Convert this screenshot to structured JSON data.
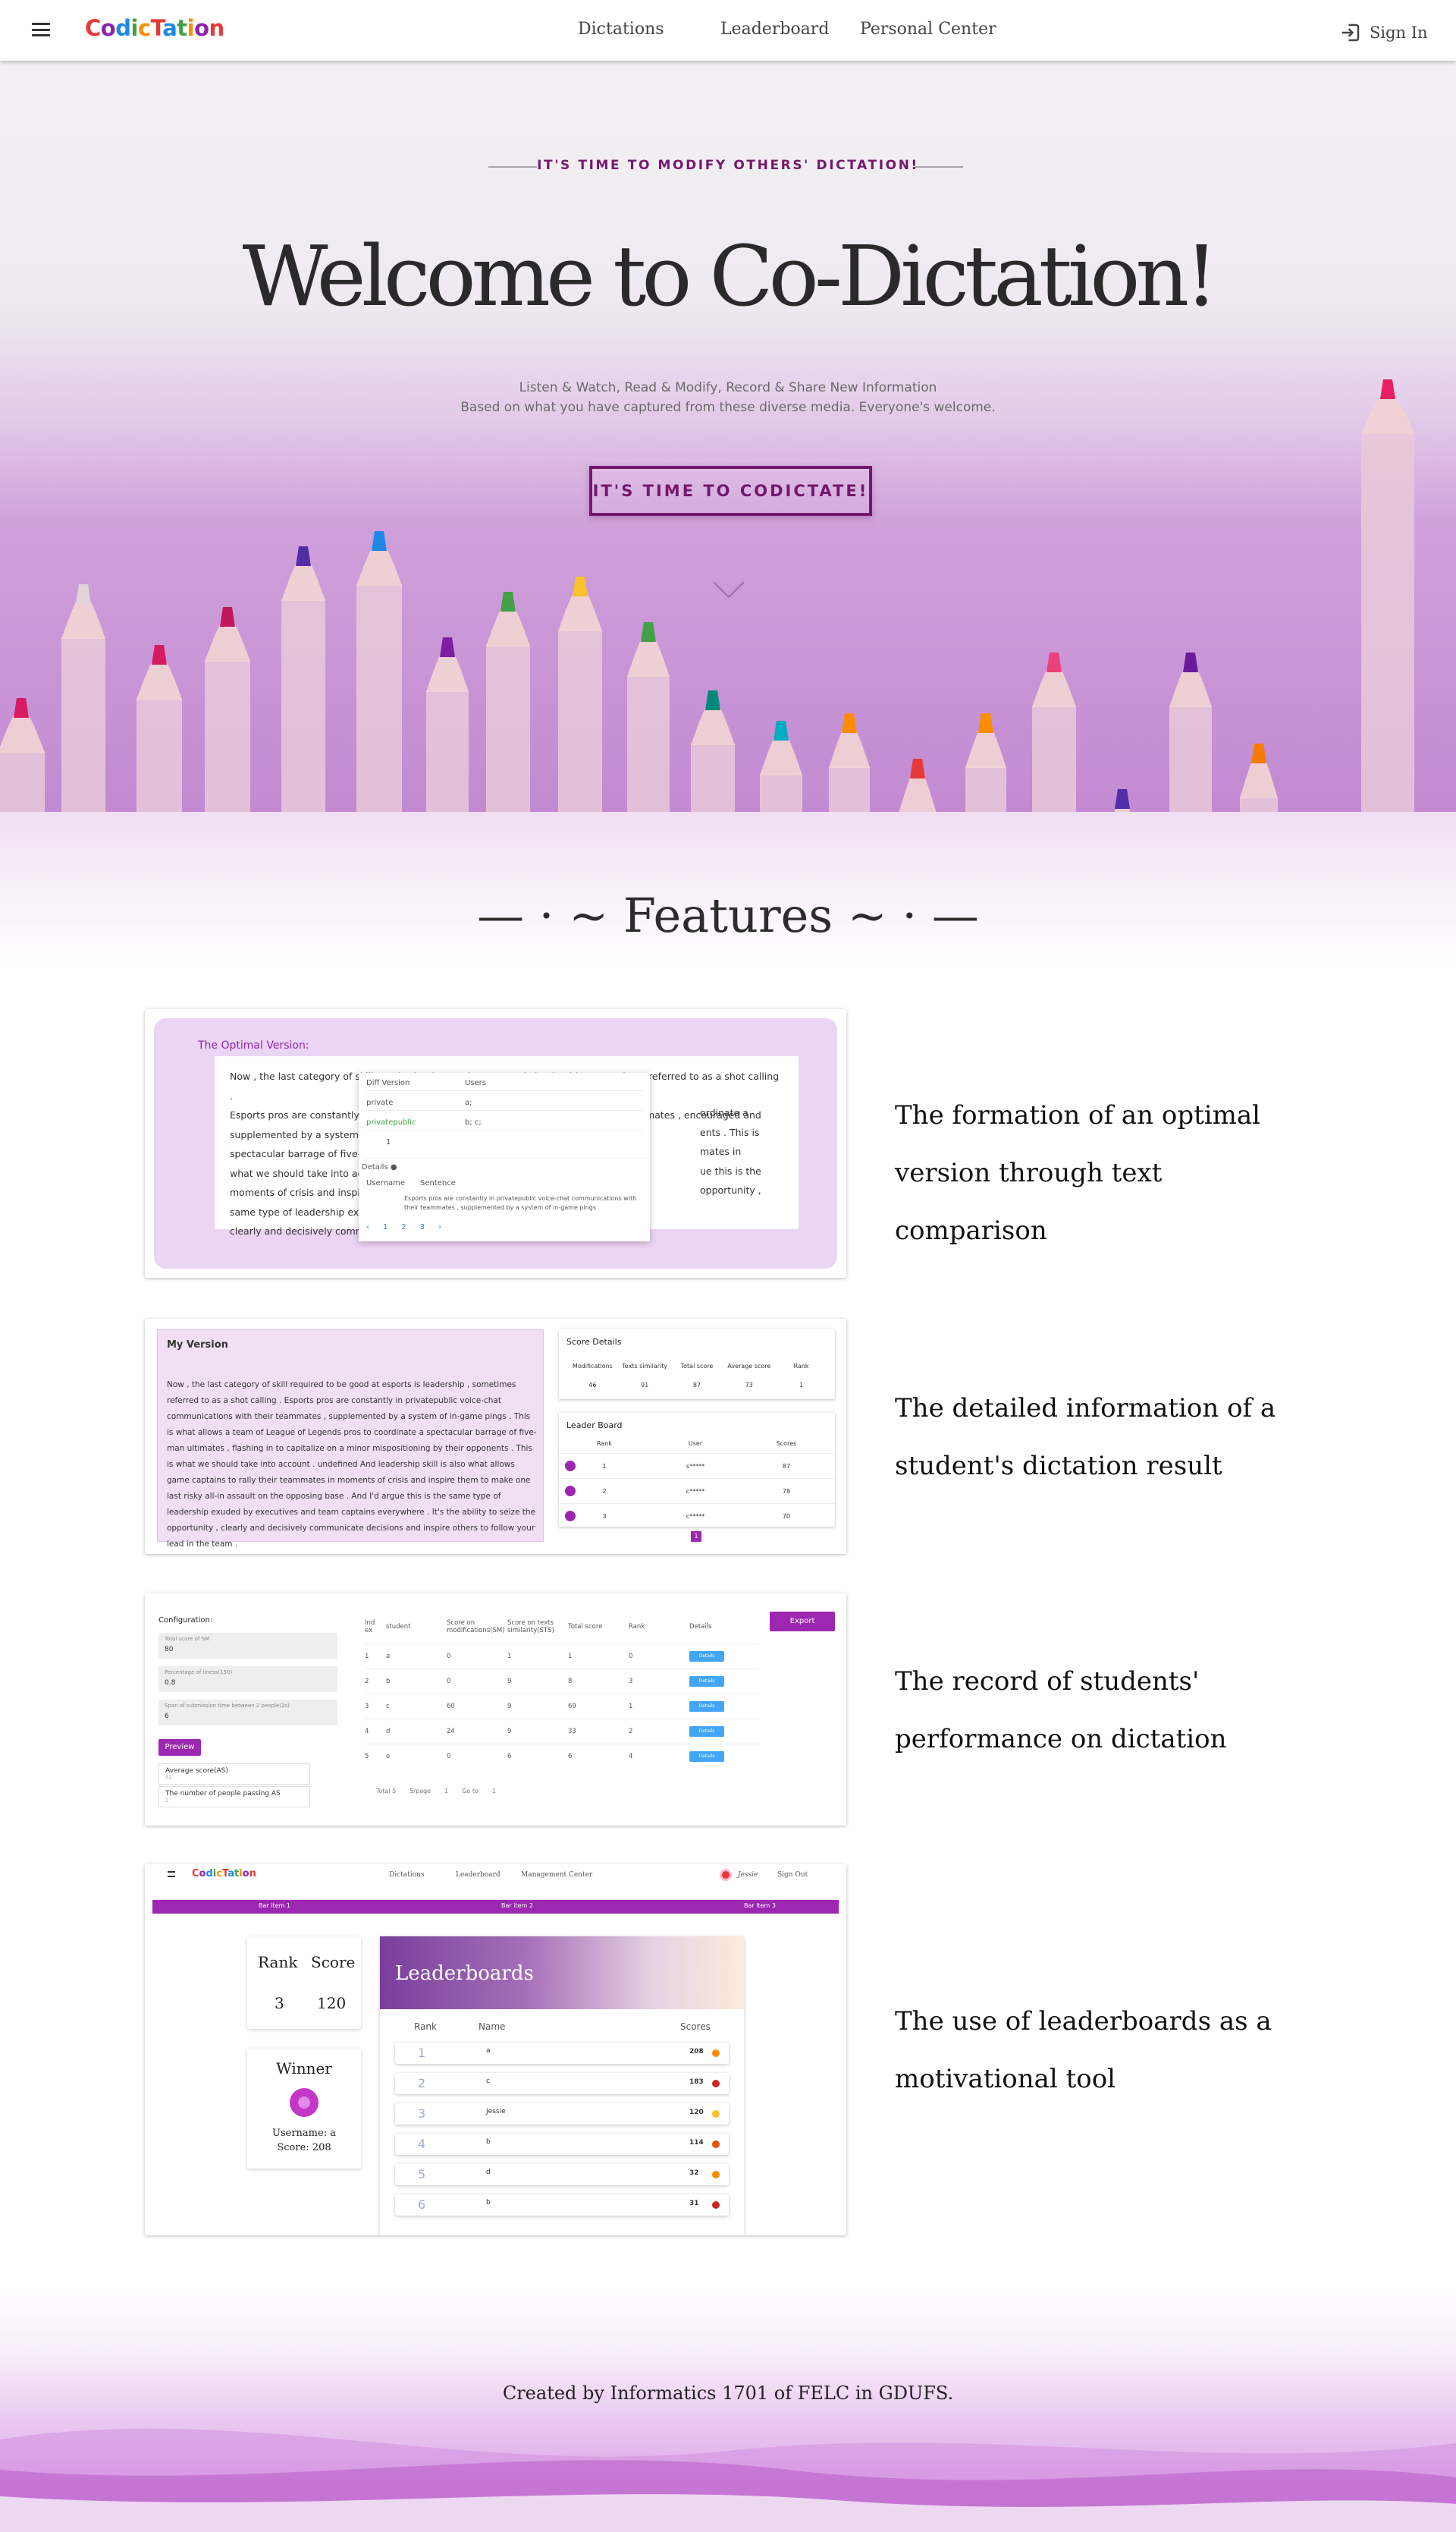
{
  "nav": {
    "logo": [
      {
        "ch": "C",
        "color": "#e53935"
      },
      {
        "ch": "o",
        "color": "#8e24aa"
      },
      {
        "ch": "d",
        "color": "#1e88e5"
      },
      {
        "ch": "i",
        "color": "#43a047"
      },
      {
        "ch": "c",
        "color": "#fb8c00"
      },
      {
        "ch": "T",
        "color": "#e53935"
      },
      {
        "ch": "a",
        "color": "#1e88e5"
      },
      {
        "ch": "t",
        "color": "#43a047"
      },
      {
        "ch": "i",
        "color": "#fb8c00"
      },
      {
        "ch": "o",
        "color": "#8e24aa"
      },
      {
        "ch": "n",
        "color": "#e53935"
      }
    ],
    "links": [
      "Dictations",
      "Leaderboard",
      "Personal Center"
    ],
    "sign_in": "Sign In",
    "sign_in_icon": "sign-in-icon",
    "menu_icon": "hamburger-icon"
  },
  "hero": {
    "tagline": "IT'S TIME TO MODIFY OTHERS' DICTATION!",
    "title": "Welcome to Co-Dictation!",
    "subtitle_line1": "Listen & Watch, Read & Modify, Record & Share New Information",
    "subtitle_line2": "Based on what you have captured from these diverse media. Everyone's welcome.",
    "cta": "IT'S TIME TO CODICTATE!",
    "scroll_icon": "chevron-down-icon"
  },
  "features": {
    "title": "— · ~ Features ~ · —",
    "items": [
      "The formation of an optimal version through text comparison",
      "The detailed information of a student's dictation result",
      "The record of students' performance on dictation",
      "The use of leaderboards as a motivational tool"
    ]
  },
  "card1": {
    "label": "The Optimal Version:",
    "lines": [
      "Now , the last category of skill required to be good at esports is leadership , sometimes referred to as a shot calling .",
      "Esports pros are constantly in privatepublic voice-chat communications with their teammates , encouraged and",
      "supplemented by a system of in-game ping",
      "spectacular barrage of five-man ultimates .",
      "what we should take into account . And lea",
      "moments of crisis and inspire them to mak",
      "same type of leadership exuded by executi",
      "clearly and decisively communicate decisio"
    ],
    "right_frag": [
      "ordinate a",
      "ents . This is",
      "mates in",
      "ue this is the",
      "opportunity ,"
    ],
    "popup": {
      "col1": "Diff Version",
      "col2": "Users",
      "row1": [
        "private",
        "a;"
      ],
      "row2": [
        "privatepublic",
        "b; c;"
      ],
      "row3": "1",
      "details": "Details",
      "h1": "Username",
      "h2": "Sentence",
      "sentence": "Esports pros are constantly in privatepublic voice-chat communications with their teammates , supplemented by a system of in-game pings",
      "pages": [
        "1",
        "2",
        "3"
      ]
    }
  },
  "card2": {
    "heading": "My Version",
    "text": "Now , the last category of skill required to be good at esports is leadership , sometimes referred to as a shot calling . Esports pros are constantly in privatepublic voice-chat communications with their teammates , supplemented by a system of in-game pings . This is what allows a team of League of Legends pros to coordinate a spectacular barrage of five-man ultimates , flashing in to capitalize on a minor mispositioning by their opponents . This is what we should take into account . undefined And leadership skill is also what allows game captains to rally their teammates in moments of crisis and inspire them to make one last risky all-in assault on the opposing base . And I'd argue this is the same type of leadership exuded by executives and team captains everywhere . It's the ability to seize the opportunity , clearly and decisively communicate decisions and inspire others to follow your lead in the team .",
    "score_title": "Score Details",
    "score_headers": [
      "Modifications",
      "Texts similarity",
      "Total score",
      "Average score",
      "Rank"
    ],
    "score_values": [
      "46",
      "91",
      "87",
      "73",
      "1"
    ],
    "lb_title": "Leader Board",
    "lb_headers": [
      "Rank",
      "User",
      "Scores"
    ],
    "lb_rows": [
      [
        "1",
        "s*****",
        "87"
      ],
      [
        "2",
        "c*****",
        "78"
      ],
      [
        "3",
        "c*****",
        "70"
      ]
    ],
    "page": "1"
  },
  "card3": {
    "config": "Configuration:",
    "fields": [
      {
        "label": "Total score of SM",
        "value": "80"
      },
      {
        "label": "Percentage of liness(150)",
        "value": "0.8"
      },
      {
        "label": "Span of submission time between 2 people(2s)",
        "value": "6"
      }
    ],
    "preview": "Preview",
    "stats": [
      "Average score(AS)",
      "The number of people passing AS"
    ],
    "stats_values": [
      "51",
      "2"
    ],
    "export": "Export",
    "headers": [
      "Ind ex",
      "student",
      "Score on modifications(SM)",
      "Score on texts similarity(STS)",
      "Total score",
      "Rank",
      "Details"
    ],
    "rows": [
      [
        "1",
        "a",
        "0",
        "1",
        "1",
        "0",
        "Details"
      ],
      [
        "2",
        "b",
        "0",
        "9",
        "8",
        "3",
        "Details"
      ],
      [
        "3",
        "c",
        "60",
        "9",
        "69",
        "1",
        "Details"
      ],
      [
        "4",
        "d",
        "24",
        "9",
        "33",
        "2",
        "Details"
      ],
      [
        "5",
        "e",
        "0",
        "6",
        "6",
        "4",
        "Details"
      ]
    ],
    "pager": [
      "Total 5",
      "5/page",
      "1",
      "Go to",
      "1"
    ]
  },
  "card4": {
    "links": [
      "Dictations",
      "Leaderboard",
      "Management Center"
    ],
    "user": "Jessie",
    "signout": "Sign Out",
    "bar": [
      "Bar item 1",
      "Bar item 2",
      "Bar item 3"
    ],
    "rank_label": "Rank",
    "score_label": "Score",
    "rank": "3",
    "score": "120",
    "winner": "Winner",
    "winner_user": "Username: a",
    "winner_score": "Score: 208",
    "lb_title": "Leaderboards",
    "lb_headers": [
      "Rank",
      "Name",
      "Scores"
    ],
    "lb_rows": [
      {
        "rank": "1",
        "name": "a",
        "score": "208"
      },
      {
        "rank": "2",
        "name": "c",
        "score": "183"
      },
      {
        "rank": "3",
        "name": "Jessie",
        "score": "120"
      },
      {
        "rank": "4",
        "name": "b",
        "score": "114"
      },
      {
        "rank": "5",
        "name": "d",
        "score": "32"
      },
      {
        "rank": "6",
        "name": "b",
        "score": "31"
      }
    ]
  },
  "footer": {
    "text": "Created by Informatics 1701 of FELC in GDUFS."
  },
  "colors": {
    "brand_purple": "#74186d",
    "accent_purple": "#9c27b0",
    "details_blue": "#42a5f5"
  }
}
